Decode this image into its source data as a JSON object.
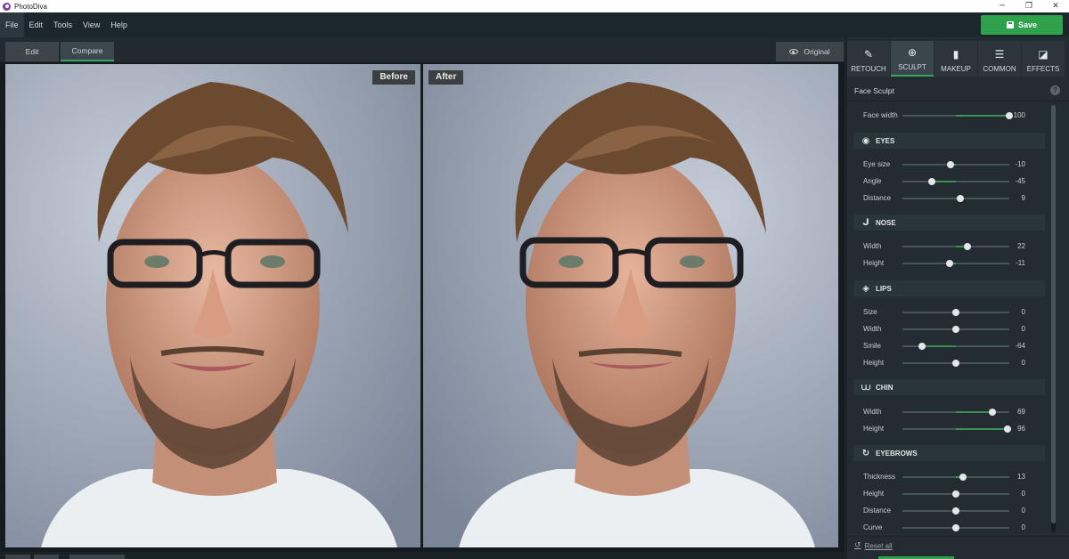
{
  "window": {
    "app_title": "PhotoDiva",
    "minimize": "─",
    "restore": "❐",
    "close": "✕"
  },
  "menu": [
    "File",
    "Edit",
    "Tools",
    "View",
    "Help"
  ],
  "save_button": {
    "label": "Save"
  },
  "toolbar": {
    "edit_tab": "Edit",
    "compare_tab": "Compare",
    "original_button": "Original"
  },
  "canvas": {
    "before_label": "Before",
    "after_label": "After"
  },
  "panel_tabs": [
    {
      "label": "RETOUCH",
      "icon": "retouch-icon",
      "glyph": "✎"
    },
    {
      "label": "SCULPT",
      "icon": "sculpt-icon",
      "glyph": "⊕"
    },
    {
      "label": "MAKEUP",
      "icon": "makeup-icon",
      "glyph": "▮"
    },
    {
      "label": "COMMON",
      "icon": "sliders-icon",
      "glyph": "☰"
    },
    {
      "label": "EFFECTS",
      "icon": "effects-icon",
      "glyph": "◪"
    }
  ],
  "panel": {
    "header": "Face Sculpt",
    "help": "?",
    "reset_all": "Reset all"
  },
  "face_width": {
    "label": "Face width",
    "value": 100,
    "min": -100,
    "max": 100
  },
  "sections": {
    "eyes": {
      "title": "EYES",
      "icon": "eye-icon",
      "sliders": [
        {
          "label": "Eye size",
          "value": -10
        },
        {
          "label": "Angle",
          "value": -45
        },
        {
          "label": "Distance",
          "value": 9
        }
      ]
    },
    "nose": {
      "title": "NOSE",
      "icon": "nose-icon",
      "sliders": [
        {
          "label": "Width",
          "value": 22
        },
        {
          "label": "Height",
          "value": -11
        }
      ]
    },
    "lips": {
      "title": "LIPS",
      "icon": "lips-icon",
      "sliders": [
        {
          "label": "Size",
          "value": 0
        },
        {
          "label": "Width",
          "value": 0
        },
        {
          "label": "Smile",
          "value": -64
        },
        {
          "label": "Height",
          "value": 0
        }
      ]
    },
    "chin": {
      "title": "CHIN",
      "icon": "chin-icon",
      "sliders": [
        {
          "label": "Width",
          "value": 69
        },
        {
          "label": "Height",
          "value": 96
        }
      ]
    },
    "eyebrows": {
      "title": "EYEBROWS",
      "icon": "eyebrows-icon",
      "sliders": [
        {
          "label": "Thickness",
          "value": 13
        },
        {
          "label": "Height",
          "value": 0
        },
        {
          "label": "Distance",
          "value": 0
        },
        {
          "label": "Curve",
          "value": 0
        }
      ]
    }
  },
  "colors": {
    "accent_green": "#2fa14a",
    "panel_bg": "#222c32",
    "menu_bg": "#1c272d"
  }
}
